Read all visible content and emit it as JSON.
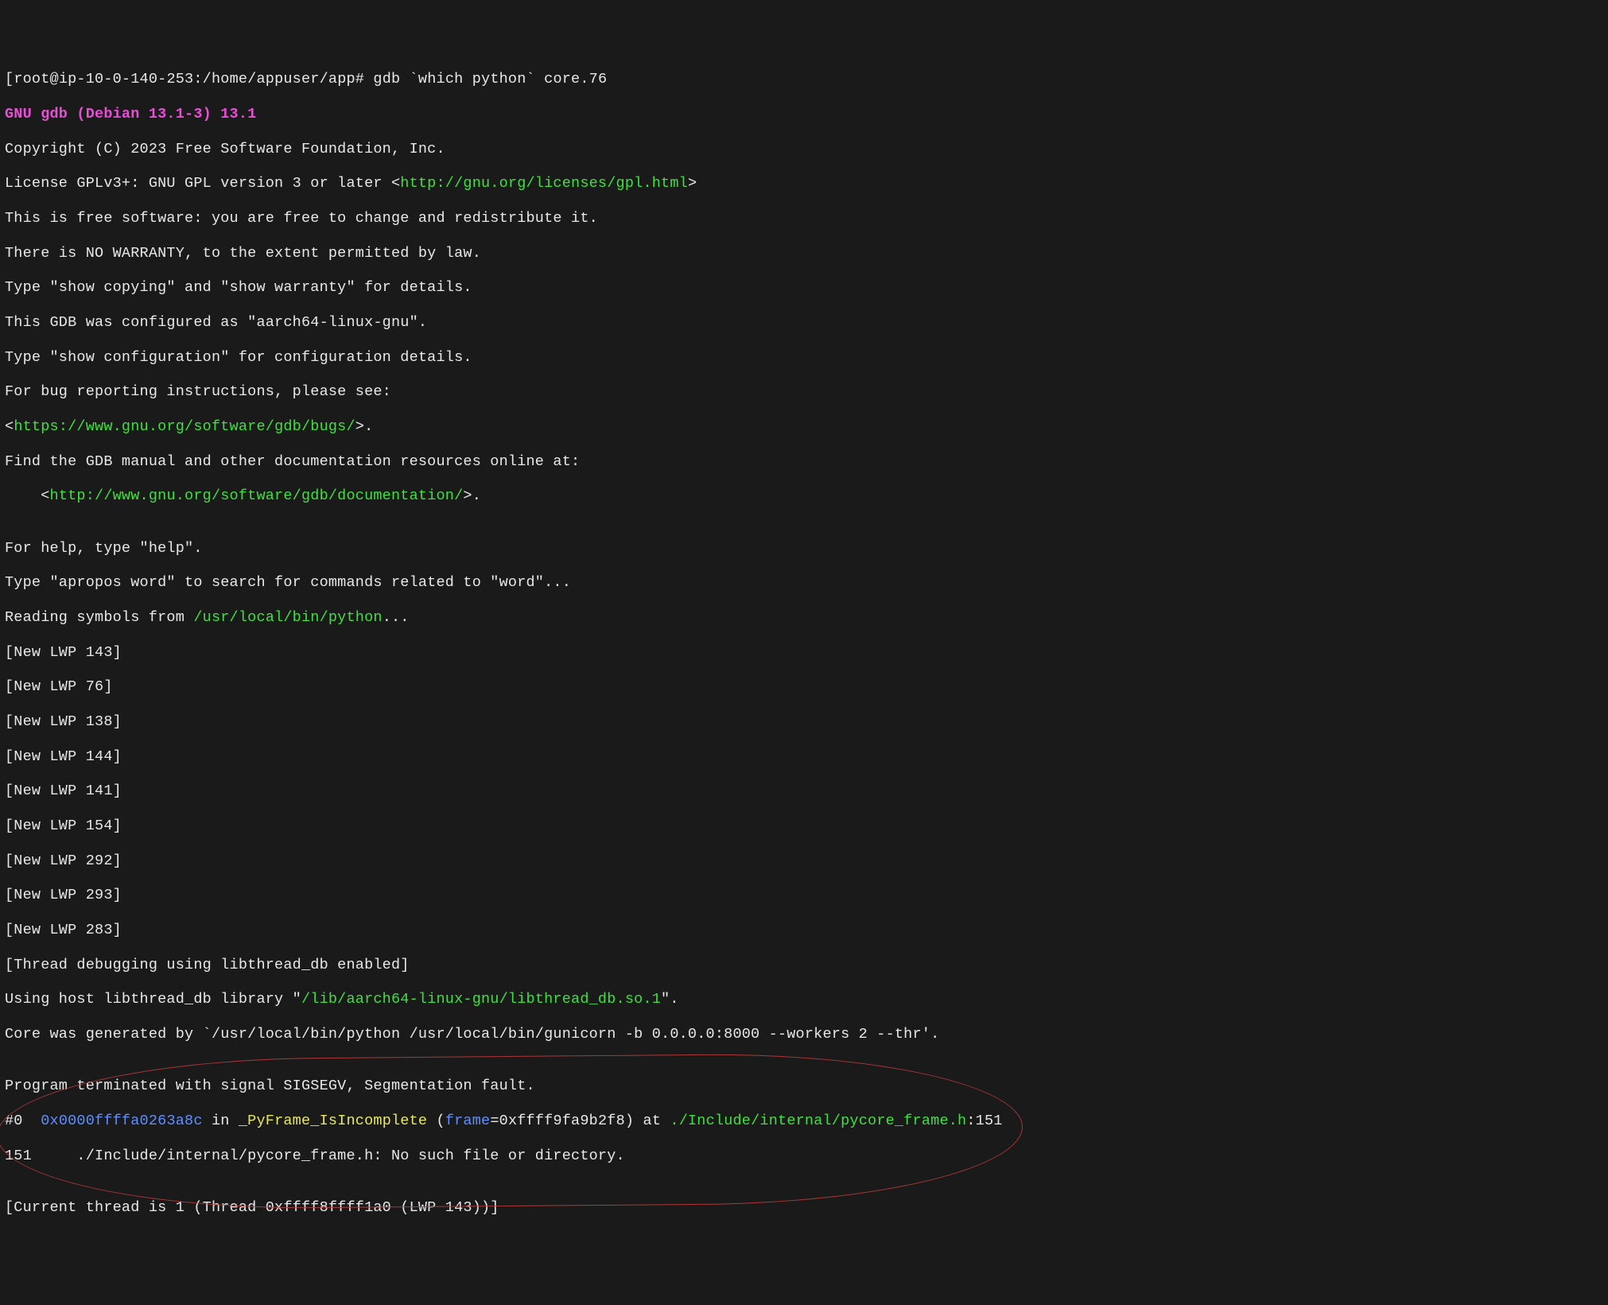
{
  "prompt": {
    "bracket_open": "[",
    "userhost": "root@ip-10-0-140-253",
    "path": ":/home/appuser/app# ",
    "command": "gdb `which python` core.76"
  },
  "gdb_banner": "GNU gdb (Debian 13.1-3) 13.1",
  "copyright": "Copyright (C) 2023 Free Software Foundation, Inc.",
  "license_pre": "License GPLv3+: GNU GPL version 3 or later <",
  "license_url": "http://gnu.org/licenses/gpl.html",
  "license_post": ">",
  "free_sw": "This is free software: you are free to change and redistribute it.",
  "no_warranty": "There is NO WARRANTY, to the extent permitted by law.",
  "show_copying": "Type \"show copying\" and \"show warranty\" for details.",
  "configured": "This GDB was configured as \"aarch64-linux-gnu\".",
  "show_config": "Type \"show configuration\" for configuration details.",
  "bug_report": "For bug reporting instructions, please see:",
  "bug_url_pre": "<",
  "bug_url": "https://www.gnu.org/software/gdb/bugs/",
  "bug_url_post": ">.",
  "find_manual": "Find the GDB manual and other documentation resources online at:",
  "doc_url_pre": "    <",
  "doc_url": "http://www.gnu.org/software/gdb/documentation/",
  "doc_url_post": ">.",
  "blank": "",
  "help_line": "For help, type \"help\".",
  "apropos": "Type \"apropos word\" to search for commands related to \"word\"...",
  "reading_pre": "Reading symbols from ",
  "reading_path": "/usr/local/bin/python",
  "reading_post": "...",
  "lwps": [
    "[New LWP 143]",
    "[New LWP 76]",
    "[New LWP 138]",
    "[New LWP 144]",
    "[New LWP 141]",
    "[New LWP 154]",
    "[New LWP 292]",
    "[New LWP 293]",
    "[New LWP 283]"
  ],
  "thread_db": "[Thread debugging using libthread_db enabled]",
  "host_lib_pre": "Using host libthread_db library \"",
  "host_lib_path": "/lib/aarch64-linux-gnu/libthread_db.so.1",
  "host_lib_post": "\".",
  "core_gen": "Core was generated by `/usr/local/bin/python /usr/local/bin/gunicorn -b 0.0.0.0:8000 --workers 2 --thr'.",
  "terminated": "Program terminated with signal SIGSEGV, Segmentation fault.",
  "frame0": {
    "num": "#0  ",
    "addr": "0x0000ffffa0263a8c",
    "in": " in ",
    "func": "_PyFrame_IsIncomplete",
    "paren_open": " (",
    "argname": "frame",
    "argval": "=0xffff9fa9b2f8) at ",
    "file": "./Include/internal/pycore_frame.h",
    "colon": ":",
    "lineno": "151"
  },
  "no_such": "151     ./Include/internal/pycore_frame.h: No such file or directory.",
  "current_thread": "[Current thread is 1 (Thread 0xffff8ffff1a0 (LWP 143))]"
}
